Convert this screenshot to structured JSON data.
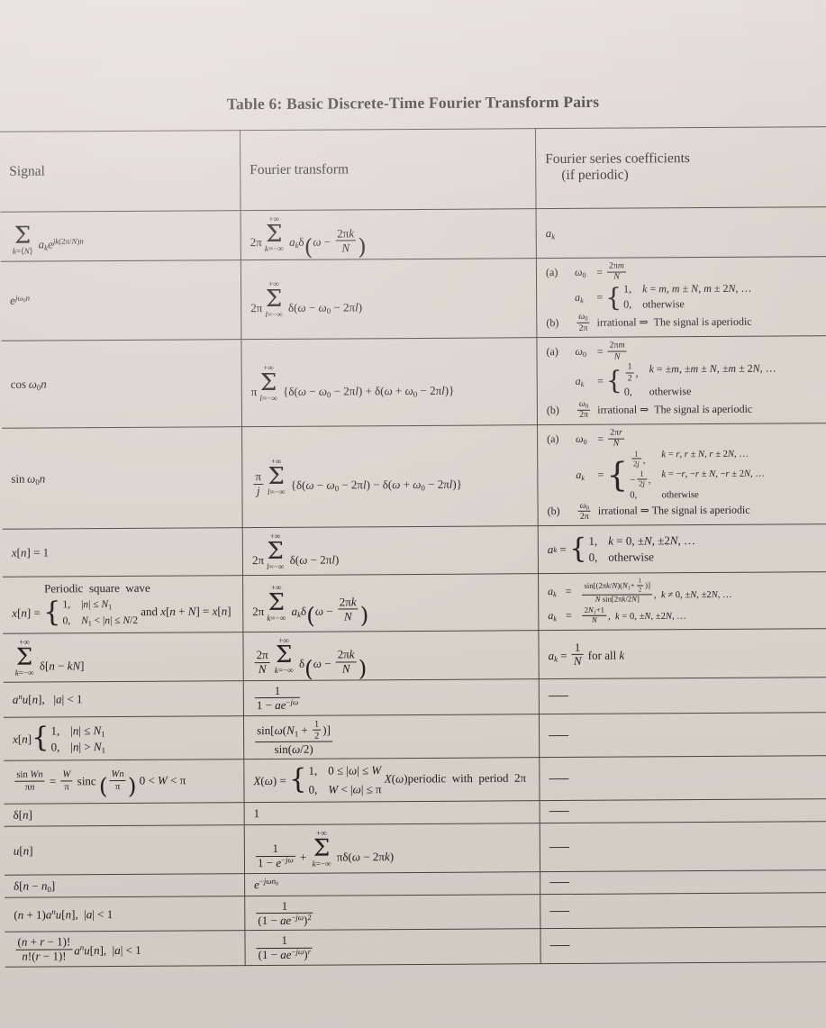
{
  "document": {
    "title": "Table 6: Basic Discrete-Time Fourier Transform Pairs",
    "background_color": "#d9d2cb",
    "ink_color": "#23201e"
  },
  "table": {
    "headers": {
      "col1": "Signal",
      "col2": "Fourier transform",
      "col3_line1": "Fourier series coefficients",
      "col3_line2": "(if periodic)"
    },
    "rows": [
      {
        "signal": "sum over k=<N> of a_k e^{jk(2pi/N)n}",
        "transform": "2pi sum_{k=-inf}^{+inf} a_k delta(omega - 2pi k / N)",
        "coefficients": "a_k"
      },
      {
        "signal": "e^{j omega_0 n}",
        "transform": "2pi sum_{l=-inf}^{+inf} delta(omega - omega_0 - 2pi l)",
        "coefficients": {
          "a_label": "(a)",
          "a_omega": "omega_0 = 2pi m / N",
          "a_cases": [
            {
              "value": "1,",
              "cond": "k = m, m ± N, m ± 2N, ..."
            },
            {
              "value": "0,",
              "cond": "otherwise"
            }
          ],
          "b_label": "(b)",
          "b_text": "omega_0 / 2pi  irrational ⇒ The signal is aperiodic"
        }
      },
      {
        "signal": "cos omega_0 n",
        "transform": "pi sum_{l=-inf}^{+inf} {delta(omega - omega_0 - 2pi l) + delta(omega + omega_0 - 2pi l)}",
        "coefficients": {
          "a_label": "(a)",
          "a_omega": "omega_0 = 2pi m / N",
          "a_cases": [
            {
              "value": "1/2,",
              "cond": "k = ±m, ±m ± N, ±m ± 2N, ..."
            },
            {
              "value": "0,",
              "cond": "otherwise"
            }
          ],
          "b_label": "(b)",
          "b_text": "omega_0 / 2pi  irrational ⇒ The signal is aperiodic"
        }
      },
      {
        "signal": "sin omega_0 n",
        "transform": "(pi/j) sum_{l=-inf}^{+inf} {delta(omega - omega_0 - 2pi l) - delta(omega + omega_0 - 2pi l)}",
        "coefficients": {
          "a_label": "(a)",
          "a_omega": "omega_0 = 2pi r / N",
          "a_cases": [
            {
              "value": "1/(2j),",
              "cond": "k = r, r ± N, r ± 2N, ..."
            },
            {
              "value": "-1/(2j),",
              "cond": "k = -r, -r ± N, -r ± 2N, ..."
            },
            {
              "value": "0,",
              "cond": "otherwise"
            }
          ],
          "b_label": "(b)",
          "b_text": "omega_0 / 2pi  irrational ⇒ The signal is aperiodic"
        }
      },
      {
        "signal": "x[n] = 1",
        "transform": "2pi sum_{l=-inf}^{+inf} delta(omega - 2pi l)",
        "coefficients": {
          "cases": [
            {
              "value": "1,",
              "cond": "k = 0, ±N, ±2N, ..."
            },
            {
              "value": "0,",
              "cond": "otherwise"
            }
          ]
        }
      },
      {
        "signal": "Periodic square wave; x[n] = 1 for |n| <= N_1, 0 for N_1 < |n| <= N/2; and x[n+N] = x[n]",
        "transform": "2pi sum_{k=-inf}^{+inf} a_k delta(omega - 2pi k / N)",
        "coefficients": {
          "line1": "a_k = sin[(2pi k/N)(N_1 + 1/2)] / (N sin[2pi k/2N]),  k != 0, ±N, ±2N, ...",
          "line2": "a_k = (2N_1 + 1)/N,  k = 0, ±N, ±2N, ..."
        }
      },
      {
        "signal": "sum_{k=-inf}^{+inf} delta[n - kN]",
        "transform": "(2pi/N) sum_{k=-inf}^{+inf} delta(omega - 2pi k / N)",
        "coefficients": "a_k = 1/N for all k"
      },
      {
        "signal": "a^n u[n],  |a| < 1",
        "transform": "1 / (1 - a e^{-j omega})",
        "coefficients": "—"
      },
      {
        "signal": "x[n] = 1, |n| <= N_1 ; 0, |n| > N_1",
        "transform": "sin[omega(N_1 + 1/2)] / sin(omega/2)",
        "coefficients": "—"
      },
      {
        "signal": "sin(Wn)/(pi n) = (W/pi) sinc(Wn/pi),  0 < W < pi",
        "transform": "X(omega) = 1 for 0 <= |omega| <= W, 0 for W < |omega| <= pi; X(omega) periodic with period 2pi",
        "coefficients": "—"
      },
      {
        "signal": "delta[n]",
        "transform": "1",
        "coefficients": "—"
      },
      {
        "signal": "u[n]",
        "transform": "1/(1 - e^{-j omega}) + sum_{k=-inf}^{+inf} pi delta(omega - 2pi k)",
        "coefficients": "—"
      },
      {
        "signal": "delta[n - n_0]",
        "transform": "e^{-j omega n_0}",
        "coefficients": "—"
      },
      {
        "signal": "(n + 1) a^n u[n],  |a| < 1",
        "transform": "1 / (1 - a e^{-j omega})^2",
        "coefficients": "—"
      },
      {
        "signal": "(n + r - 1)! / (n!(r - 1)!) a^n u[n],  |a| < 1",
        "transform": "1 / (1 - a e^{-j omega})^r",
        "coefficients": "—"
      }
    ],
    "em_dash": "—"
  }
}
